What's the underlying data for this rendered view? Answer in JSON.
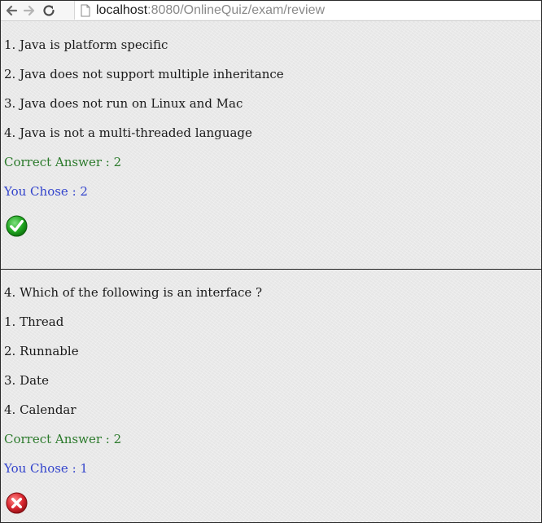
{
  "browser": {
    "url_host": "localhost",
    "url_path": ":8080/OnlineQuiz/exam/review"
  },
  "review": {
    "q3": {
      "options": [
        "1. Java is platform specific",
        "2. Java does not support multiple inheritance",
        "3. Java does not run on Linux and Mac",
        "4. Java is not a multi-threaded language"
      ],
      "correct_answer": "Correct Answer : 2",
      "you_chose": "You Chose : 2",
      "result_icon": "check-icon",
      "result_color": "#19a019"
    },
    "q4": {
      "question": "4. Which of the following is an interface ?",
      "options": [
        "1. Thread",
        "2. Runnable",
        "3. Date",
        "4. Calendar"
      ],
      "correct_answer": "Correct Answer : 2",
      "you_chose": "You Chose : 1",
      "result_icon": "cross-icon",
      "result_color": "#d9262f"
    }
  },
  "colors": {
    "correct_text": "#2b7a2b",
    "chose_text": "#3344cc"
  }
}
